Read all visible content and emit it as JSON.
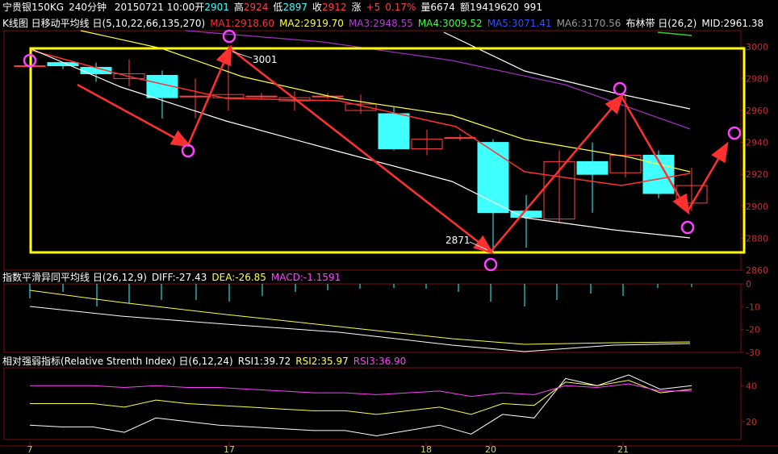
{
  "header": {
    "instrument": "宁贵银150KG",
    "period": "240分钟",
    "datetime": "20150721 10:00",
    "open_label": "开",
    "open": "2901",
    "high_label": "高",
    "high": "2924",
    "low_label": "低",
    "low": "2897",
    "close_label": "收",
    "close": "2912",
    "change_label": "涨",
    "change": "+5",
    "change_pct": "0.17%",
    "volume_label": "量",
    "volume": "6674",
    "amount_label": "额",
    "amount": "19419620",
    "extra": "991"
  },
  "kline_legend": {
    "title": "K线图 日移动平均线 日(5,10,22,66,135,270)",
    "ma1": "MA1:2918.60",
    "ma2": "MA2:2919.70",
    "ma3": "MA3:2948.55",
    "ma4": "MA4:3009.52",
    "ma5": "MA5:3071.41",
    "ma6": "MA6:3170.56",
    "boll": "布林带 日(26,2)",
    "mid": "MID:2961.38"
  },
  "macd_legend": {
    "title": "指数平滑异同平均线 日(26,12,9)",
    "diff": "DIFF:-27.43",
    "dea": "DEA:-26.85",
    "macd": "MACD:-1.1591"
  },
  "rsi_legend": {
    "title": "相对强弱指标(Relative Strenth Index) 日(6,12,24)",
    "rsi1": "RSI1:39.72",
    "rsi2": "RSI2:35.97",
    "rsi3": "RSI3:36.90"
  },
  "colors": {
    "up": "#ff4040",
    "down": "#40ffff",
    "ma_yellow": "#ffff40",
    "ma_purple": "#a030c0",
    "white": "#ffffff",
    "red": "#ff3030",
    "annotation_box": "#ffff00",
    "circle": "#ff40ff",
    "axis_text": "#c03030"
  },
  "chart_data": [
    {
      "type": "candlestick",
      "name": "K线图",
      "ylim": [
        2860,
        3010
      ],
      "yticks": [
        2860,
        2880,
        2900,
        2920,
        2940,
        2960,
        2980,
        3000
      ],
      "xticks": [
        "7",
        "17",
        "18",
        "20",
        "21"
      ],
      "candles": [
        {
          "o": 2988,
          "c": 2988,
          "h": 2990,
          "l": 2986
        },
        {
          "o": 2990,
          "c": 2988,
          "h": 2990,
          "l": 2986
        },
        {
          "o": 2987,
          "c": 2983,
          "h": 2990,
          "l": 2978
        },
        {
          "o": 2980,
          "c": 2983,
          "h": 2992,
          "l": 2975
        },
        {
          "o": 2982,
          "c": 2968,
          "h": 2985,
          "l": 2955
        },
        {
          "o": 2969,
          "c": 2969,
          "h": 2980,
          "l": 2955
        },
        {
          "o": 2968,
          "c": 2970,
          "h": 3001,
          "l": 2960
        },
        {
          "o": 2969,
          "c": 2969,
          "h": 2971,
          "l": 2967
        },
        {
          "o": 2966,
          "c": 2968,
          "h": 2972,
          "l": 2960
        },
        {
          "o": 2969,
          "c": 2969,
          "h": 2971,
          "l": 2967
        },
        {
          "o": 2960,
          "c": 2964,
          "h": 2970,
          "l": 2958
        },
        {
          "o": 2958,
          "c": 2936,
          "h": 2962,
          "l": 2935
        },
        {
          "o": 2936,
          "c": 2942,
          "h": 2948,
          "l": 2932
        },
        {
          "o": 2943,
          "c": 2943,
          "h": 2945,
          "l": 2941
        },
        {
          "o": 2940,
          "c": 2896,
          "h": 2942,
          "l": 2871
        },
        {
          "o": 2897,
          "c": 2893,
          "h": 2907,
          "l": 2874
        },
        {
          "o": 2892,
          "c": 2928,
          "h": 2935,
          "l": 2890
        },
        {
          "o": 2928,
          "c": 2920,
          "h": 2940,
          "l": 2896
        },
        {
          "o": 2921,
          "c": 2932,
          "h": 2970,
          "l": 2918
        },
        {
          "o": 2932,
          "c": 2908,
          "h": 2935,
          "l": 2905
        },
        {
          "o": 2902,
          "c": 2913,
          "h": 2924,
          "l": 2897
        }
      ],
      "annotations": {
        "high_label": "3001",
        "low_label": "2871"
      }
    },
    {
      "type": "bar",
      "name": "指数平滑异同平均线",
      "yticks": [
        0,
        -10,
        -20,
        -30
      ],
      "ylim": [
        -30,
        0
      ]
    },
    {
      "type": "line",
      "name": "相对强弱指标",
      "yticks": [
        20,
        40
      ],
      "ylim": [
        10,
        50
      ],
      "series": [
        {
          "name": "RSI1",
          "values": [
            18,
            17,
            17,
            14,
            22,
            20,
            18,
            17,
            16,
            15,
            15,
            12,
            15,
            18,
            13,
            24,
            22,
            44,
            40,
            46,
            38,
            40
          ]
        },
        {
          "name": "RSI2",
          "values": [
            30,
            30,
            30,
            28,
            32,
            30,
            29,
            28,
            27,
            26,
            26,
            24,
            26,
            28,
            24,
            30,
            29,
            42,
            40,
            43,
            36,
            38
          ]
        },
        {
          "name": "RSI3",
          "values": [
            40,
            40,
            40,
            39,
            40,
            39,
            39,
            38,
            37,
            36,
            36,
            35,
            36,
            37,
            34,
            36,
            35,
            40,
            39,
            41,
            37,
            37
          ]
        }
      ]
    }
  ]
}
